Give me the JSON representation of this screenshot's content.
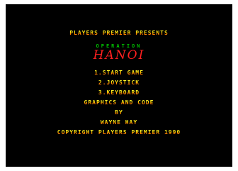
{
  "title_screen": {
    "presents": "PLAYERS PREMIER PRESENTS",
    "operation": "OPERATION",
    "game_title": "HANOI",
    "menu": [
      {
        "label": "1.START GAME"
      },
      {
        "label": "2.JOYSTICK"
      },
      {
        "label": "3.KEYBOARD"
      }
    ],
    "credits_heading": "GRAPHICS AND CODE",
    "credits_by": "BY",
    "credits_author": "WAYNE HAY",
    "copyright": "COPYRIGHT PLAYERS PREMIER 1990"
  },
  "colors": {
    "background": "#000000",
    "text_top": "#ffff40",
    "text_bottom": "#ff6a00",
    "operation": "#00c000",
    "title": "#ff2020"
  }
}
